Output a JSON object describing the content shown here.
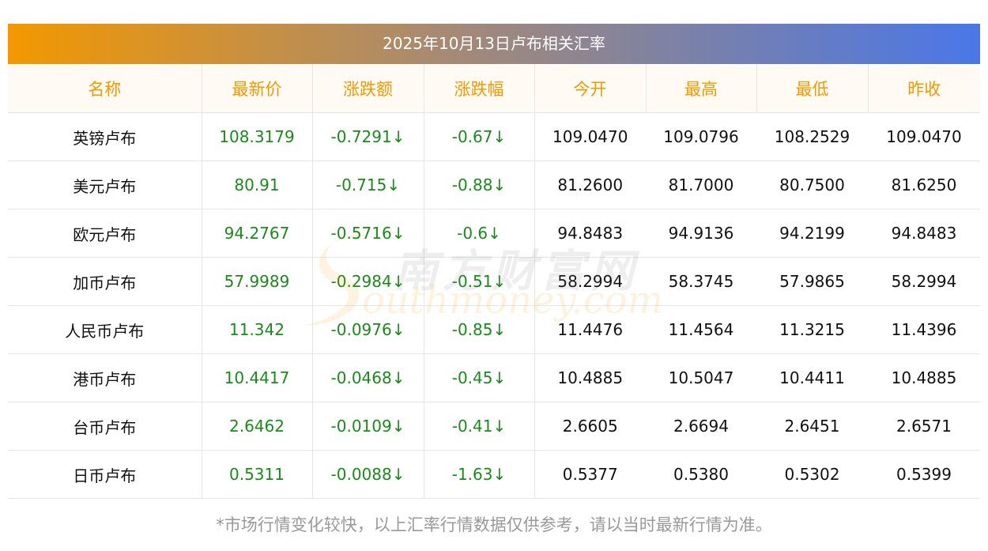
{
  "title": "2025年10月13日卢布相关汇率",
  "headers": [
    "名称",
    "最新价",
    "涨跌额",
    "涨跌幅",
    "今开",
    "最高",
    "最低",
    "昨收"
  ],
  "rows": [
    [
      "英镑卢布",
      "108.3179",
      "-0.7291↓",
      "-0.67↓",
      "109.0470",
      "109.0796",
      "108.2529",
      "109.0470"
    ],
    [
      "美元卢布",
      "80.91",
      "-0.715↓",
      "-0.88↓",
      "81.2600",
      "81.7000",
      "80.7500",
      "81.6250"
    ],
    [
      "欧元卢布",
      "94.2767",
      "-0.5716↓",
      "-0.6↓",
      "94.8483",
      "94.9136",
      "94.2199",
      "94.8483"
    ],
    [
      "加币卢布",
      "57.9989",
      "-0.2984↓",
      "-0.51↓",
      "58.2994",
      "58.3745",
      "57.9865",
      "58.2994"
    ],
    [
      "人民币卢布",
      "11.342",
      "-0.0976↓",
      "-0.85↓",
      "11.4476",
      "11.4564",
      "11.3215",
      "11.4396"
    ],
    [
      "港币卢布",
      "10.4417",
      "-0.0468↓",
      "-0.45↓",
      "10.4885",
      "10.5047",
      "10.4411",
      "10.4885"
    ],
    [
      "台币卢布",
      "2.6462",
      "-0.0109↓",
      "-0.41↓",
      "2.6605",
      "2.6694",
      "2.6451",
      "2.6571"
    ],
    [
      "日币卢布",
      "0.5311",
      "-0.0088↓",
      "-1.63↓",
      "0.5377",
      "0.5380",
      "0.5302",
      "0.5399"
    ]
  ],
  "watermark": {
    "cn": "南方财富网",
    "en": "outhmoney.com"
  },
  "footnote": "*市场行情变化较快，以上汇率行情数据仅供参考，请以当时最新行情为准。",
  "colors": {
    "header_text": "#f39800",
    "down_green": "#1b8a1b",
    "gradient_start": "#f39800",
    "gradient_end": "#4a77e8"
  }
}
